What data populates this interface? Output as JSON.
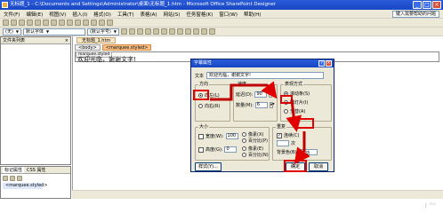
{
  "window": {
    "title": "无标题_1 - C:\\Documents and Settings\\Administrator\\桌面\\无标题_1.htm - Microsoft Office SharePoint Designer",
    "min": "_",
    "max": "□",
    "close": "×"
  },
  "menu": {
    "items": [
      "文件(F)",
      "编辑(E)",
      "视图(V)",
      "插入(I)",
      "格式(O)",
      "工具(T)",
      "表格(A)",
      "网站(S)",
      "任务窗格(K)",
      "窗口(W)",
      "帮助(H)"
    ],
    "help_box": "键入需要帮助的问题"
  },
  "toolbar": {
    "style_select": "默认字体",
    "size_select": "(默认字号)",
    "font_select": "(无)"
  },
  "left_panel": {
    "title": "文件夹列表",
    "close": "×"
  },
  "bottom_panel": {
    "tabs": [
      "标记属性",
      "CSS 属性"
    ],
    "item": "<marquee.styled>"
  },
  "document": {
    "tab_label": "无标题_1.htm",
    "crumbs": [
      "<body>",
      "<marquee.styled>"
    ],
    "marquee_tag": "marquee.styled",
    "marquee_text": "欢迎光临，谢谢文字!"
  },
  "dialog": {
    "title": "字幕属性",
    "text_label": "文本",
    "text_value": "欢迎光临，谢谢文字!",
    "direction_label": "方向",
    "dir_left": "向左(L)",
    "dir_right": "向右(R)",
    "speed_label": "速度",
    "delay_label": "延迟(D):",
    "delay_value": "90",
    "amount_label": "数量(M):",
    "amount_value": "6",
    "style_label": "表现方式",
    "style_scroll": "滚动条(S)",
    "style_slide": "幻灯片(I)",
    "style_alternate": "交替(A)",
    "size_label": "大小",
    "width_label": "宽度(W):",
    "width_value": "100",
    "height_label": "高度(G):",
    "height_value": "0",
    "unit_pixels1": "像素(X)",
    "unit_percent1": "百分比(P)",
    "unit_pixels2": "像素(E)",
    "unit_percent2": "百分比(N)",
    "repeat_label": "重复",
    "repeat_cont": "连续(C)",
    "times_label": "次",
    "bg_label": "背景色(B):",
    "bg_value": "自动",
    "style_button": "样式(Y)...",
    "ok": "确定",
    "cancel": "取消"
  },
  "watermark": "ı ᵇᵃ"
}
